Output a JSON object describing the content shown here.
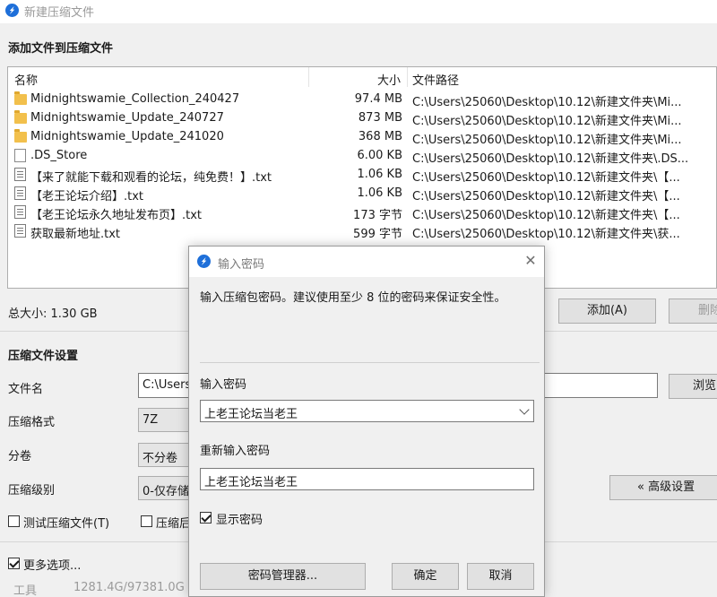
{
  "main_window": {
    "title": "新建压缩文件",
    "add_files_heading": "添加文件到压缩文件",
    "file_list": {
      "columns": {
        "name": "名称",
        "size": "大小",
        "path": "文件路径"
      },
      "rows": [
        {
          "type": "folder",
          "name": "Midnightswamie_Collection_240427",
          "size": "97.4 MB",
          "path": "C:\\Users\\25060\\Desktop\\10.12\\新建文件夹\\Mi..."
        },
        {
          "type": "folder",
          "name": "Midnightswamie_Update_240727",
          "size": "873 MB",
          "path": "C:\\Users\\25060\\Desktop\\10.12\\新建文件夹\\Mi..."
        },
        {
          "type": "folder",
          "name": "Midnightswamie_Update_241020",
          "size": "368 MB",
          "path": "C:\\Users\\25060\\Desktop\\10.12\\新建文件夹\\Mi..."
        },
        {
          "type": "file",
          "name": ".DS_Store",
          "size": "6.00 KB",
          "path": "C:\\Users\\25060\\Desktop\\10.12\\新建文件夹\\.DS..."
        },
        {
          "type": "text",
          "name": "【来了就能下载和观看的论坛，纯免费！】.txt",
          "size": "1.06 KB",
          "path": "C:\\Users\\25060\\Desktop\\10.12\\新建文件夹\\【..."
        },
        {
          "type": "text",
          "name": "【老王论坛介绍】.txt",
          "size": "1.06 KB",
          "path": "C:\\Users\\25060\\Desktop\\10.12\\新建文件夹\\【..."
        },
        {
          "type": "text",
          "name": "【老王论坛永久地址发布页】.txt",
          "size": "173 字节",
          "path": "C:\\Users\\25060\\Desktop\\10.12\\新建文件夹\\【..."
        },
        {
          "type": "text",
          "name": "获取最新地址.txt",
          "size": "599 字节",
          "path": "C:\\Users\\25060\\Desktop\\10.12\\新建文件夹\\获..."
        }
      ]
    },
    "total_size": "总大小: 1.30 GB",
    "add_button": "添加(A)",
    "delete_button": "删除",
    "settings_heading": "压缩文件设置",
    "filename_label": "文件名",
    "filename_value": "C:\\Users",
    "browse_button": "浏览",
    "format_label": "压缩格式",
    "format_value": "7Z",
    "split_label": "分卷",
    "split_value": "不分卷",
    "level_label": "压缩级别",
    "level_value": "0-仅存储",
    "advanced_button": "« 高级设置",
    "test_archive_label": "测试压缩文件(T)",
    "test_archive_checked": false,
    "after_compress_label": "压缩后",
    "after_compress_checked": false,
    "more_options_label": "更多选项...",
    "more_options_checked": true,
    "bottom_text_left": "工具",
    "bottom_text_disk": "1281.4G/97381.0G"
  },
  "password_dialog": {
    "title": "输入密码",
    "description": "输入压缩包密码。建议使用至少 8 位的密码来保证安全性。",
    "password_label": "输入密码",
    "password_value": "上老王论坛当老王",
    "reenter_label": "重新输入密码",
    "reenter_value": "上老王论坛当老王",
    "show_password_label": "显示密码",
    "show_password_checked": true,
    "password_manager_button": "密码管理器...",
    "ok_button": "确定",
    "cancel_button": "取消"
  },
  "colors": {
    "window_bg": "#f0f0f0",
    "accent": "#1e6fd9",
    "folder": "#f2c04c"
  }
}
